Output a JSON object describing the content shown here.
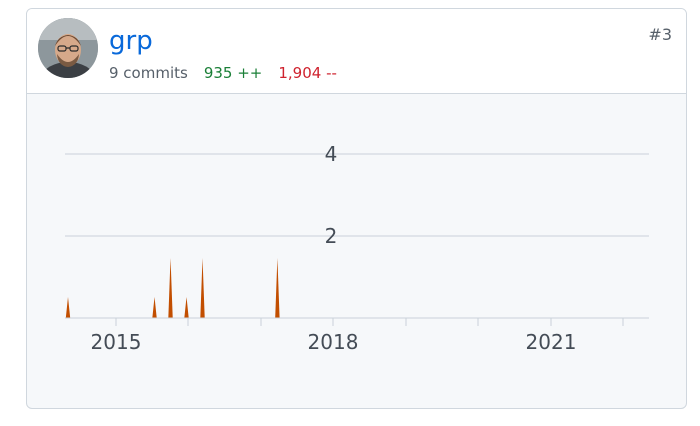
{
  "contributor": {
    "username": "grp",
    "rank": "#3",
    "commits_label": "9 commits",
    "additions_label": "935 ++",
    "deletions_label": "1,904 --",
    "avatar_icon": "avatar-photo"
  },
  "colors": {
    "link": "#0969da",
    "additions": "#1a7f37",
    "deletions": "#cf222e",
    "series": "#c24e00"
  },
  "chart_data": {
    "type": "area",
    "x_tick_labels": [
      "2015",
      "2018",
      "2021"
    ],
    "y_tick_labels": [
      "2",
      "4"
    ],
    "ylim": [
      0,
      5
    ],
    "grid": true,
    "series": [
      {
        "points": [
          {
            "x": 2014.25,
            "y": 1
          },
          {
            "x": 2015.13,
            "y": 1
          },
          {
            "x": 2015.35,
            "y": 2
          },
          {
            "x": 2015.57,
            "y": 1
          },
          {
            "x": 2015.79,
            "y": 2
          },
          {
            "x": 2016.82,
            "y": 2
          }
        ]
      }
    ]
  }
}
